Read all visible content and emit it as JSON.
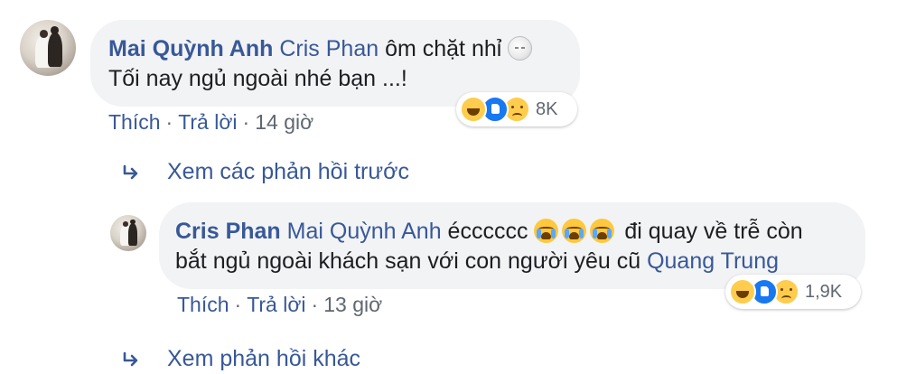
{
  "comment1": {
    "author": "Mai Quỳnh Anh",
    "mention": "Cris Phan",
    "text_line1": "ôm chặt nhỉ",
    "emoji_after_line1": "moon-face-emoji",
    "text_line2": "Tối nay ngủ ngoài nhé bạn ...!",
    "actions": {
      "like": "Thích",
      "reply": "Trả lời",
      "time": "14 giờ",
      "separator": "·"
    },
    "reactions": {
      "icons": [
        "haha",
        "like",
        "sad"
      ],
      "count": "8K"
    }
  },
  "view_previous": {
    "label": "Xem các phản hồi trước",
    "icon": "reply-arrow-icon"
  },
  "comment2": {
    "author": "Cris Phan",
    "mention": "Mai Quỳnh Anh",
    "text_before_emoji": "écccccc",
    "emojis": [
      "crying-face-emoji",
      "crying-face-emoji",
      "crying-face-emoji"
    ],
    "text_after_emoji": "đi quay về trễ còn",
    "text_line2": "bắt ngủ ngoài khách sạn với con người yêu cũ",
    "mention2": "Quang Trung",
    "actions": {
      "like": "Thích",
      "reply": "Trả lời",
      "time": "13 giờ",
      "separator": "·"
    },
    "reactions": {
      "icons": [
        "haha",
        "like",
        "sad"
      ],
      "count": "1,9K"
    }
  },
  "view_more": {
    "label": "Xem phản hồi khác",
    "icon": "reply-arrow-icon"
  },
  "colors": {
    "link": "#385898",
    "bubble": "#f2f3f5",
    "meta": "#606770"
  }
}
